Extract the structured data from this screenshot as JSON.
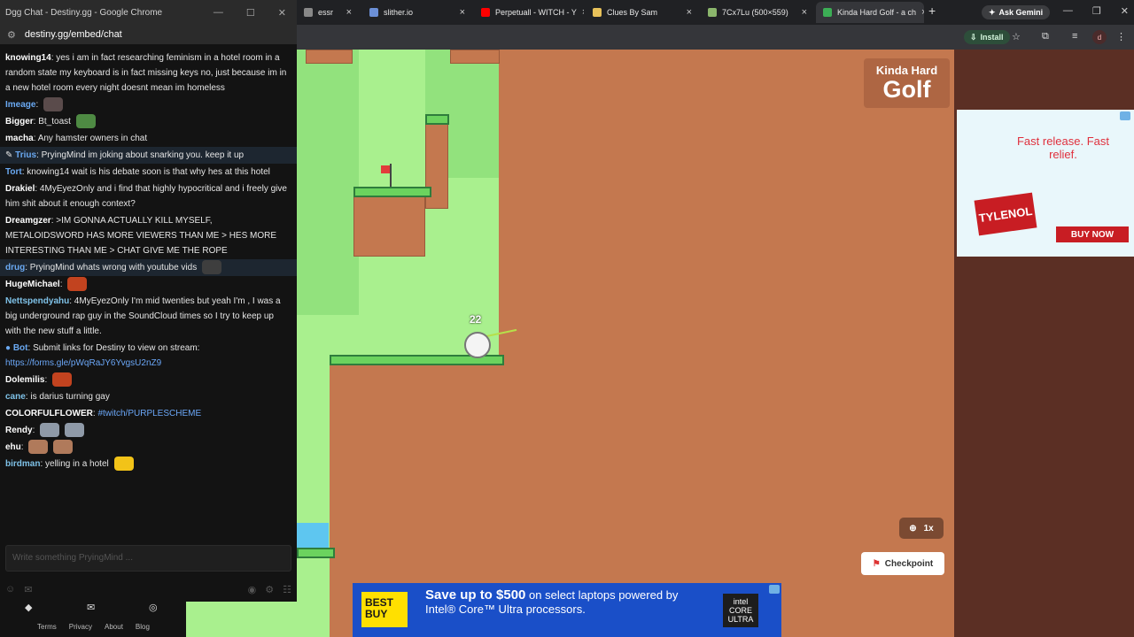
{
  "browser": {
    "tabs": [
      {
        "label": "essr",
        "color": "#888888"
      },
      {
        "label": "slither.io",
        "color": "#6b8fd6"
      },
      {
        "label": "Perpetuall - WITCH - Y",
        "color": "#ff0000"
      },
      {
        "label": "Clues By Sam",
        "color": "#e8c15a"
      },
      {
        "label": "7Cx7Lu (500×559)",
        "color": "#8bb66c"
      },
      {
        "label": "Kinda Hard Golf - a ch",
        "color": "#3cae55"
      }
    ],
    "ask_gemini": "Ask Gemini",
    "install_label": "Install",
    "profile_initial": "d"
  },
  "chat_window": {
    "title": "Dgg Chat - Destiny.gg - Google Chrome",
    "url": "destiny.gg/embed/chat",
    "messages": [
      {
        "user": "knowing14",
        "text": "yes i am in fact researching feminism in a hotel room in a random state my keyboard is in fact missing keys no, just because im in a new hotel room every night doesnt mean im homeless"
      },
      {
        "user": "Imeage",
        "text": "",
        "style": "blue"
      },
      {
        "user": "Bigger",
        "text": "Bt_toast"
      },
      {
        "user": "macha",
        "text": "Any hamster owners in chat"
      },
      {
        "user": "Trius",
        "text": "PryingMind im joking about snarking you. keep it up",
        "style": "blue",
        "highlight": true
      },
      {
        "user": "Tort",
        "text": "knowing14 wait is his debate soon is that why hes at this hotel",
        "style": "blue"
      },
      {
        "user": "Drakiel",
        "text": "4MyEyezOnly and i find that highly hypocritical and i freely give him shit about it enough context?"
      },
      {
        "user": "Dreamgzer",
        "text": ">IM GONNA ACTUALLY KILL MYSELF, METALOIDSWORD HAS MORE VIEWERS THAN ME > HES MORE INTERESTING THAN ME > CHAT GIVE ME THE ROPE"
      },
      {
        "user": "drug",
        "text": "PryingMind whats wrong with youtube vids",
        "style": "blue",
        "highlight": true
      },
      {
        "user": "HugeMichael",
        "text": ""
      },
      {
        "user": "Nettspendyahu",
        "text": "4MyEyezOnly I'm mid twenties but yeah I'm , I was a big underground rap guy in the SoundCloud times so I try to keep up with the new stuff a little.",
        "style": "cyan"
      },
      {
        "user": "Bot",
        "text": "Submit links for Destiny to view on stream:",
        "style": "blue",
        "link": "https://forms.gle/pWqRaJY6YvgsU2nZ9"
      },
      {
        "user": "Dolemilis",
        "text": ""
      },
      {
        "user": "cane",
        "text": "is darius turning gay",
        "style": "cyan"
      },
      {
        "user": "COLORFULFLOWER",
        "text": "",
        "link": "#twitch/PURPLESCHEME"
      },
      {
        "user": "Rendy",
        "text": ""
      },
      {
        "user": "ehu",
        "text": ""
      },
      {
        "user": "birdman",
        "text": "yelling in a hotel",
        "style": "cyan"
      }
    ],
    "input_placeholder": "Write something PryingMind ...",
    "footer_links": [
      "Terms",
      "Privacy",
      "About",
      "Blog"
    ]
  },
  "game": {
    "title_small": "Kinda Hard",
    "title_big": "Golf",
    "stroke_count": "22",
    "zoom_label": "1x",
    "checkpoint_label": "Checkpoint"
  },
  "ads": {
    "right": {
      "slogan": "Fast release. Fast relief.",
      "brand": "TYLENOL",
      "cta": "BUY NOW"
    },
    "bottom": {
      "brand": "BEST BUY",
      "headline": "Save up to $500",
      "body": "on select laptops powered by Intel® Core™ Ultra processors.",
      "chip": "intel CORE ULTRA"
    }
  }
}
